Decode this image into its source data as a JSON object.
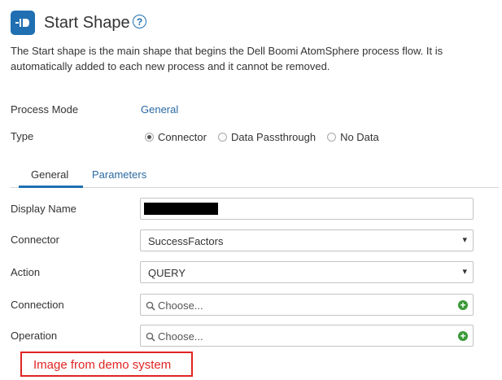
{
  "header": {
    "icon": "start-shape-icon",
    "title": "Start Shape",
    "help_icon": "question-mark-icon",
    "help_glyph": "?"
  },
  "description": "The Start shape is the main shape that begins the Dell Boomi AtomSphere process flow. It is automatically added to each new process and it cannot be removed.",
  "process_mode": {
    "label": "Process Mode",
    "value": "General"
  },
  "type": {
    "label": "Type",
    "options": [
      {
        "label": "Connector",
        "selected": true
      },
      {
        "label": "Data Passthrough",
        "selected": false
      },
      {
        "label": "No Data",
        "selected": false
      }
    ]
  },
  "tabs": [
    {
      "label": "General",
      "active": true
    },
    {
      "label": "Parameters",
      "active": false
    }
  ],
  "form": {
    "display_name": {
      "label": "Display Name",
      "value_redacted": true
    },
    "connector": {
      "label": "Connector",
      "value": "SuccessFactors",
      "caret": "▾"
    },
    "action": {
      "label": "Action",
      "value": "QUERY",
      "caret": "▾"
    },
    "connection": {
      "label": "Connection",
      "placeholder": "Choose...",
      "add_glyph": "+"
    },
    "operation": {
      "label": "Operation",
      "placeholder": "Choose...",
      "add_glyph": "+"
    }
  },
  "annotation": {
    "text": "Image from demo system",
    "color": "#e02424"
  },
  "colors": {
    "accent": "#1f6fb2",
    "link": "#2a6aa3",
    "add": "#3a9a38"
  }
}
